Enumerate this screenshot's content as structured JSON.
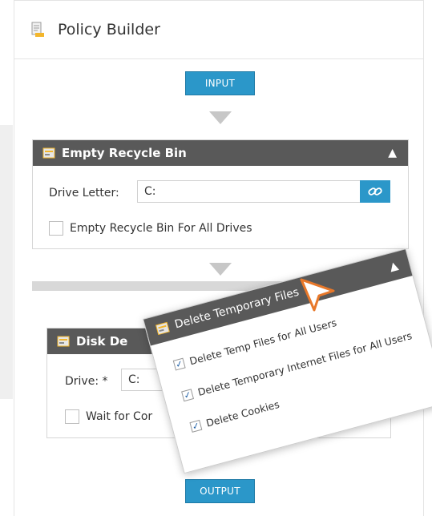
{
  "header": {
    "title": "Policy Builder",
    "icon": "document-icon"
  },
  "flow": {
    "input_label": "INPUT",
    "output_label": "OUTPUT"
  },
  "card_recycle": {
    "title": "Empty Recycle Bin",
    "drive_letter_label": "Drive Letter:",
    "drive_letter_value": "C:",
    "all_drives_label": "Empty Recycle Bin For All Drives"
  },
  "card_disk": {
    "title": "Disk De",
    "drive_label": "Drive: *",
    "drive_value": "C:",
    "wait_label": "Wait for Cor"
  },
  "popup": {
    "title": "Delete Temporary Files",
    "items": [
      {
        "label": "Delete Temp Files for All Users",
        "checked": "✓"
      },
      {
        "label": "Delete Temporary Internet Files for All Users",
        "checked": "✓"
      },
      {
        "label": "Delete Cookies",
        "checked": "✓"
      }
    ]
  },
  "colors": {
    "accent": "#2b97c9",
    "card_header": "#595959",
    "cursor": "#e8782a"
  }
}
